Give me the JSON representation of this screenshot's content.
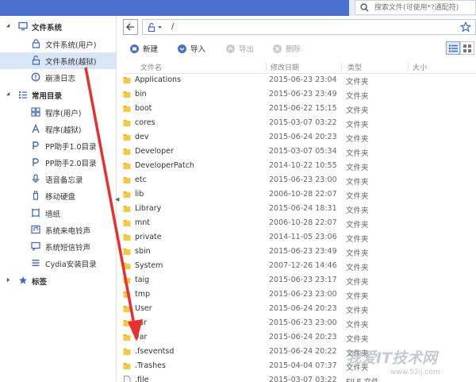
{
  "topbar": {
    "search_placeholder": "搜索文件(可使用*?通配符)"
  },
  "sidebar": {
    "groups": [
      {
        "label": "文件系统",
        "icon": "monitor-icon",
        "items": [
          {
            "label": "文件系统(用户)",
            "icon": "lock-icon",
            "selected": false
          },
          {
            "label": "文件系统(越狱)",
            "icon": "unlock-icon",
            "selected": true
          },
          {
            "label": "崩溃日志",
            "icon": "alert-icon",
            "selected": false
          }
        ]
      },
      {
        "label": "常用目录",
        "icon": "list-icon",
        "items": [
          {
            "label": "程序(用户)",
            "icon": "app-icon",
            "selected": false
          },
          {
            "label": "程序(越狱)",
            "icon": "appstore-icon",
            "selected": false
          },
          {
            "label": "PP助手1.0目录",
            "icon": "pp-icon",
            "selected": false
          },
          {
            "label": "PP助手2.0目录",
            "icon": "pp-icon",
            "selected": false
          },
          {
            "label": "语音备忘录",
            "icon": "mic-icon",
            "selected": false
          },
          {
            "label": "移动硬盘",
            "icon": "usb-icon",
            "selected": false
          },
          {
            "label": "墙纸",
            "icon": "wallpaper-icon",
            "selected": false
          },
          {
            "label": "系统来电铃声",
            "icon": "ringtone-icon",
            "selected": false
          },
          {
            "label": "系统短信铃声",
            "icon": "sms-tone-icon",
            "selected": false
          },
          {
            "label": "Cydia安装目录",
            "icon": "cydia-list-icon",
            "selected": false
          }
        ]
      },
      {
        "label": "标签",
        "icon": "star-icon",
        "items": []
      }
    ]
  },
  "pathbar": {
    "path": "/"
  },
  "toolbar": {
    "new_label": "新建",
    "import_label": "导入",
    "export_label": "导出",
    "delete_label": "删除"
  },
  "table": {
    "columns": [
      "文件名",
      "修改日期",
      "类型",
      "大小"
    ],
    "rows": [
      {
        "name": "Applications",
        "date": "2015-06-23 23:04",
        "type": "文件夹",
        "size": ""
      },
      {
        "name": "bin",
        "date": "2015-06-23 23:49",
        "type": "文件夹",
        "size": ""
      },
      {
        "name": "boot",
        "date": "2015-06-22 15:15",
        "type": "文件夹",
        "size": ""
      },
      {
        "name": "cores",
        "date": "2015-03-07 03:22",
        "type": "文件夹",
        "size": ""
      },
      {
        "name": "dev",
        "date": "2015-06-24 20:23",
        "type": "文件夹",
        "size": ""
      },
      {
        "name": "Developer",
        "date": "2015-03-07 05:34",
        "type": "文件夹",
        "size": ""
      },
      {
        "name": "DeveloperPatch",
        "date": "2014-10-22 10:55",
        "type": "文件夹",
        "size": ""
      },
      {
        "name": "etc",
        "date": "2015-06-23 23:00",
        "type": "文件夹",
        "size": ""
      },
      {
        "name": "lib",
        "date": "2006-10-28 22:07",
        "type": "文件夹",
        "size": ""
      },
      {
        "name": "Library",
        "date": "2015-06-24 18:31",
        "type": "文件夹",
        "size": ""
      },
      {
        "name": "mnt",
        "date": "2006-10-28 22:07",
        "type": "文件夹",
        "size": ""
      },
      {
        "name": "private",
        "date": "2014-11-05 23:06",
        "type": "文件夹",
        "size": ""
      },
      {
        "name": "sbin",
        "date": "2015-06-23 23:49",
        "type": "文件夹",
        "size": ""
      },
      {
        "name": "System",
        "date": "2007-12-26 14:46",
        "type": "文件夹",
        "size": ""
      },
      {
        "name": "taig",
        "date": "2015-06-23 23:17",
        "type": "文件夹",
        "size": ""
      },
      {
        "name": "tmp",
        "date": "2015-06-23 23:00",
        "type": "文件夹",
        "size": ""
      },
      {
        "name": "User",
        "date": "2015-06-24 20:23",
        "type": "文件夹",
        "size": ""
      },
      {
        "name": "usr",
        "date": "2015-06-23 23:00",
        "type": "文件夹",
        "size": ""
      },
      {
        "name": "var",
        "date": "2015-06-24 20:23",
        "type": "文件夹",
        "size": ""
      },
      {
        "name": ".fseventsd",
        "date": "2015-06-24 20:22",
        "type": "文件夹",
        "size": ""
      },
      {
        "name": ".Trashes",
        "date": "2015-04-04 07:37",
        "type": "文件夹",
        "size": ""
      },
      {
        "name": ".file",
        "date": "2015-03-07 03:22",
        "type": "FILE 文件",
        "size": ""
      }
    ]
  },
  "watermark": {
    "text": "我爱IT技术网",
    "url": "www.52ij.com"
  },
  "colors": {
    "accent": "#4a6fcf",
    "selection": "#d9e6f8",
    "folder": "#f2b824",
    "arrow": "#e8302f"
  }
}
